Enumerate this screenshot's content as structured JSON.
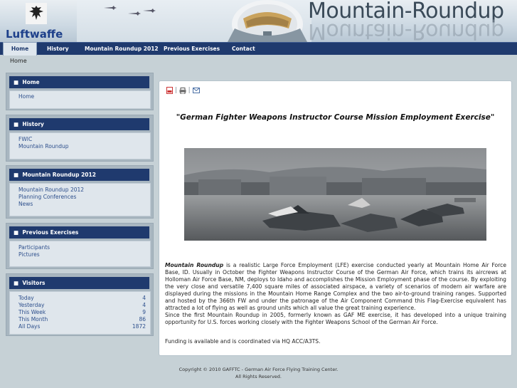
{
  "header": {
    "brand": "Luftwaffe",
    "title": "Mountain-Roundup"
  },
  "nav": {
    "items": [
      {
        "label": "Home",
        "active": true
      },
      {
        "label": "History"
      },
      {
        "label": "Mountain Roundup 2012"
      },
      {
        "label": "Previous Exercises"
      },
      {
        "label": "Contact"
      }
    ]
  },
  "breadcrumb": "Home",
  "sidebar": {
    "home": {
      "title": "Home",
      "links": [
        "Home"
      ]
    },
    "history": {
      "title": "History",
      "links": [
        "FWIC",
        "Mountain Roundup"
      ]
    },
    "mr2012": {
      "title": "Mountain Roundup 2012",
      "links": [
        "Mountain Roundup 2012",
        "Planning Conferences",
        "News"
      ]
    },
    "previous": {
      "title": "Previous Exercises",
      "links": [
        "Participants",
        "Pictures"
      ]
    },
    "visitors": {
      "title": "Visitors",
      "rows": [
        {
          "label": "Today",
          "value": "4"
        },
        {
          "label": "Yesterday",
          "value": "4"
        },
        {
          "label": "This Week",
          "value": "9"
        },
        {
          "label": "This Month",
          "value": "86"
        },
        {
          "label": "All Days",
          "value": "1872"
        }
      ]
    }
  },
  "main": {
    "icons": [
      "pdf-icon",
      "print-icon",
      "email-icon"
    ],
    "headline": "\"German Fighter Weapons Instructor Course Mission Employment Exercise\"",
    "article_lead": "Mountain Roundup",
    "article_p1": " is a realistic Large Force Employment (LFE) exercise conducted yearly at Mountain Home Air Force Base, ID. Usually in October the Fighter Weapons Instructor Course of the German Air Force, which trains its aircrews at Holloman Air Force Base, NM, deploys to Idaho and accomplishes the Mission Employment phase of the course. By exploiting the very close and versatile 7,400 square miles of associated airspace, a variety of scenarios of modern air warfare are displayed during the missions in the Mountain Home Range Complex and the two air-to-ground training ranges. Supported and hosted by the 366th FW and under the patronage of the Air Component Command this Flag-Exercise equivalent has attracted a lot of flying as well as ground units which all value the great training experience.",
    "article_p2": "Since the first Mountain Roundup in 2005, formerly known as GAF ME exercise, it has developed into a unique training opportunity for U.S. forces working closely with the Fighter Weapons School of the German Air Force.",
    "funding": "Funding is available and is coordinated via HQ ACC/A3TS."
  },
  "footer": {
    "line1": "Copyright © 2010 GAFFTC - German Air Force Flying Training Center.",
    "line2": "All Rights Reserved."
  },
  "colors": {
    "nav_bg": "#1f3a6e",
    "module_head": "#1f3a6e",
    "page_bg": "#c6d1d6",
    "link": "#2d4f8c"
  }
}
